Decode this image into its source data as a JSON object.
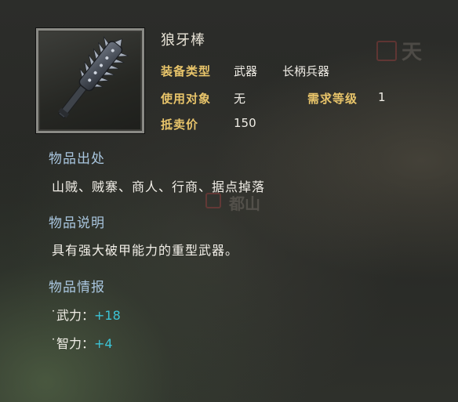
{
  "item": {
    "name": "狼牙棒",
    "icon": "spiked-club-icon",
    "props": {
      "type_label": "装备类型",
      "type_value1": "武器",
      "type_value2": "长柄兵器",
      "user_label": "使用对象",
      "user_value": "无",
      "level_label": "需求等级",
      "level_value": "1",
      "price_label": "抵卖价",
      "price_value": "150"
    }
  },
  "sections": {
    "source_title": "物品出处",
    "source_text": "山贼、贼寨、商人、行商、据点掉落",
    "desc_title": "物品说明",
    "desc_text": "具有强大破甲能力的重型武器。",
    "info_title": "物品情报",
    "stats": [
      {
        "key": "˙武力：",
        "value": "+18"
      },
      {
        "key": "˙智力：",
        "value": "+4"
      }
    ]
  },
  "background": {
    "deco_top": "天",
    "deco_mid": "都山"
  },
  "colors": {
    "label": "#e8c46a",
    "section": "#a9c6df",
    "stat_value": "#3cc4d6"
  }
}
